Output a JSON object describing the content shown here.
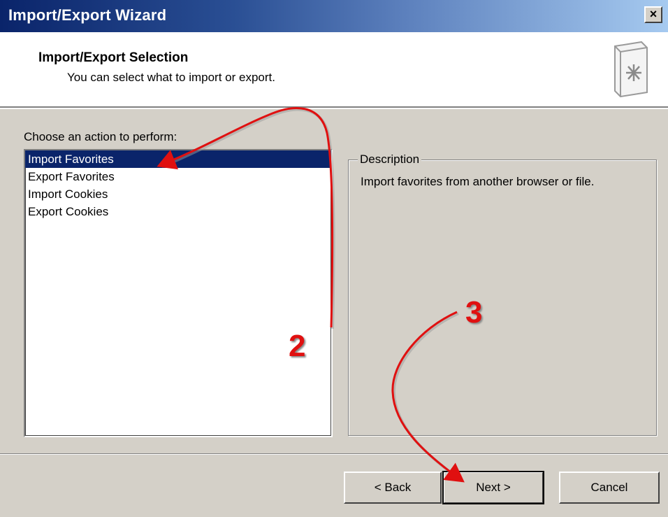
{
  "window": {
    "title": "Import/Export Wizard",
    "close_label": "×"
  },
  "header": {
    "title": "Import/Export Selection",
    "subtitle": "You can select what to import or export."
  },
  "actions": {
    "label": "Choose an action to perform:",
    "items": [
      {
        "label": "Import Favorites",
        "selected": true
      },
      {
        "label": "Export Favorites",
        "selected": false
      },
      {
        "label": "Import Cookies",
        "selected": false
      },
      {
        "label": "Export Cookies",
        "selected": false
      }
    ]
  },
  "description": {
    "legend": "Description",
    "text": "Import favorites from another browser or file."
  },
  "buttons": {
    "back": "< Back",
    "next": "Next >",
    "cancel": "Cancel"
  },
  "annotations": {
    "step_2": "2",
    "step_3": "3",
    "color": "#e01010"
  },
  "colors": {
    "titlebar_start": "#0a246a",
    "titlebar_end": "#a6caf0",
    "selection": "#0a246a",
    "face": "#d4d0c8"
  }
}
